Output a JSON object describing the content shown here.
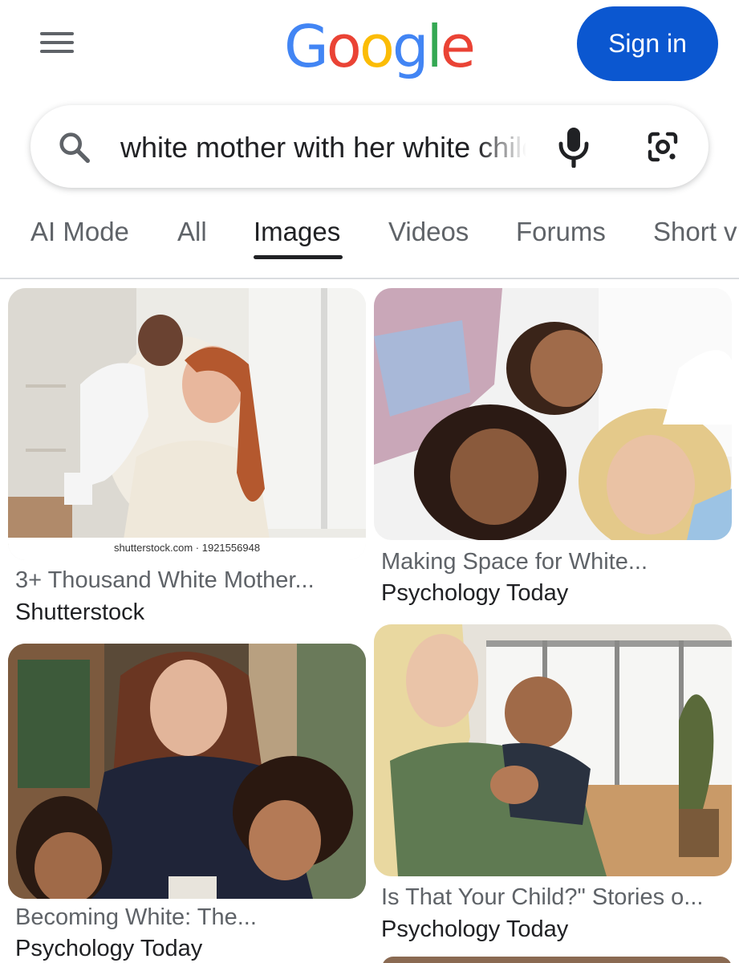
{
  "header": {
    "menu_icon": "hamburger-menu-icon",
    "logo_letters": [
      "G",
      "o",
      "o",
      "g",
      "l",
      "e"
    ],
    "logo_colors": [
      "#4285f4",
      "#ea4335",
      "#fbbc05",
      "#4285f4",
      "#34a853",
      "#ea4335"
    ],
    "sign_in_label": "Sign in",
    "accent": "#0b57d0"
  },
  "search": {
    "query": "white mother with her white children",
    "icons": [
      "search-icon",
      "microphone-icon",
      "google-lens-icon"
    ]
  },
  "tabs": [
    {
      "label": "AI Mode",
      "active": false
    },
    {
      "label": "All",
      "active": false
    },
    {
      "label": "Images",
      "active": true
    },
    {
      "label": "Videos",
      "active": false
    },
    {
      "label": "Forums",
      "active": false
    },
    {
      "label": "Short v",
      "active": false
    }
  ],
  "results": [
    {
      "title": "3+ Thousand White Mother...",
      "source": "Shutterstock",
      "watermark": "shutterstock.com · 1921556948"
    },
    {
      "title": "Making Space for White...",
      "source": "Psychology Today"
    },
    {
      "title": "Becoming White: The...",
      "source": "Psychology Today"
    },
    {
      "title": "Is That Your Child?\" Stories o...",
      "source": "Psychology Today"
    }
  ]
}
